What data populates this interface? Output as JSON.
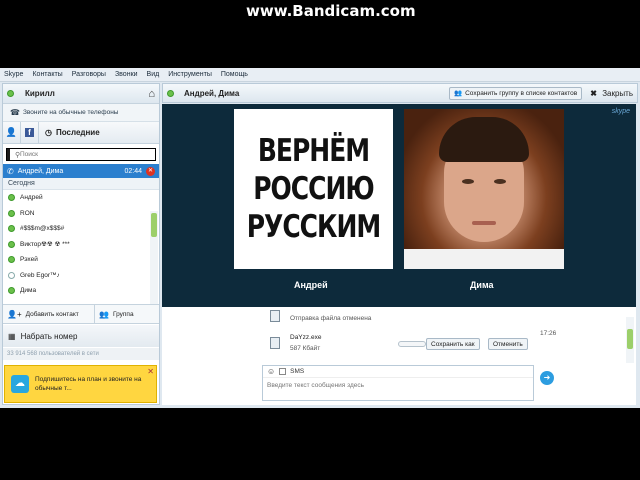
{
  "watermark": "www.Bandicam.com",
  "menu": [
    "Skype",
    "Контакты",
    "Разговоры",
    "Звонки",
    "Вид",
    "Инструменты",
    "Помощь"
  ],
  "user": {
    "name": "Кирилл"
  },
  "phone_link": "Звоните на обычные телефоны",
  "tabs": {
    "recent": "Последние"
  },
  "search": {
    "placeholder": "Поиск"
  },
  "active_call": {
    "name": "Андрей, Дима",
    "time": "02:44"
  },
  "section_today": "Сегодня",
  "contacts": [
    {
      "name": "Андрей",
      "status": "online"
    },
    {
      "name": "RON",
      "status": "online"
    },
    {
      "name": "#$$$m@x$$$#",
      "status": "online"
    },
    {
      "name": "Виктор☢☢ ☢ ***",
      "status": "online"
    },
    {
      "name": "Рэхей",
      "status": "online"
    },
    {
      "name": "Greb Egor™♪",
      "status": "offline"
    },
    {
      "name": "Дима",
      "status": "online"
    }
  ],
  "actions": {
    "add_contact": "Добавить контакт",
    "group": "Группа"
  },
  "dial": "Набрать номер",
  "online_count": "33 914 568 пользователей в сети",
  "promo": {
    "text": "Подпишитесь на план и звоните на обычные т..."
  },
  "conversation": {
    "title": "Андрей, Дима",
    "save_group": "Сохранить группу в списке контактов",
    "close": "Закрыть"
  },
  "video": {
    "slogan": [
      "ВЕРНЁМ",
      "РОССИЮ",
      "РУССКИМ"
    ],
    "left_label": "Андрей",
    "right_label": "Дима",
    "skype_logo": "skype"
  },
  "chat": {
    "cancelled": "Отправка файла отменена",
    "file_name": "DaYzz.exe",
    "file_size": "587 Кбайт",
    "time": "17:26",
    "save_as": "Сохранить как",
    "cancel": "Отменить",
    "sms": "SMS",
    "input_placeholder": "Введите текст сообщения здесь"
  }
}
